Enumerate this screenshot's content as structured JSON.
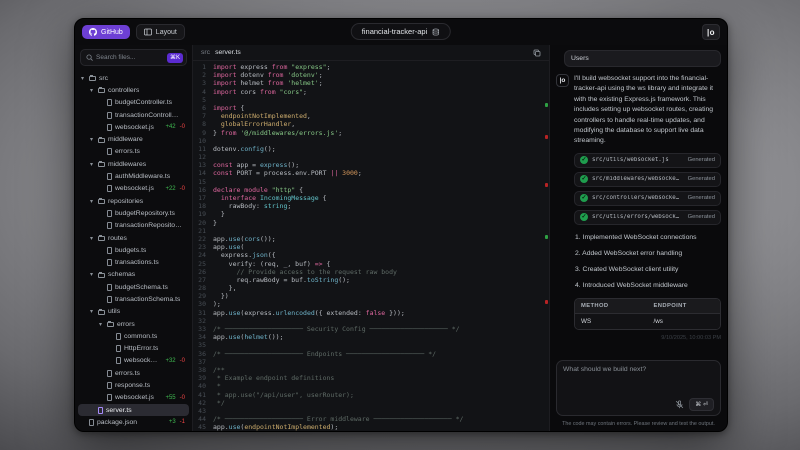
{
  "window": {
    "title": "financial-tracker-api"
  },
  "topbar": {
    "github_label": "GitHub",
    "layout_label": "Layout",
    "logo": "|o"
  },
  "sidebar": {
    "search": {
      "placeholder": "Search files...",
      "shortcut": "⌘K"
    },
    "tree": [
      {
        "d": 0,
        "t": "folder",
        "label": "src"
      },
      {
        "d": 1,
        "t": "folder",
        "label": "controllers"
      },
      {
        "d": 2,
        "t": "file",
        "label": "budgetController.ts"
      },
      {
        "d": 2,
        "t": "file",
        "label": "transactionController.ts"
      },
      {
        "d": 2,
        "t": "file",
        "label": "websocket.js",
        "add": "+42",
        "del": "-0"
      },
      {
        "d": 1,
        "t": "folder",
        "label": "middleware"
      },
      {
        "d": 2,
        "t": "file",
        "label": "errors.ts"
      },
      {
        "d": 1,
        "t": "folder",
        "label": "middlewares"
      },
      {
        "d": 2,
        "t": "file",
        "label": "authMiddleware.ts"
      },
      {
        "d": 2,
        "t": "file",
        "label": "websocket.js",
        "add": "+22",
        "del": "-0"
      },
      {
        "d": 1,
        "t": "folder",
        "label": "repositories"
      },
      {
        "d": 2,
        "t": "file",
        "label": "budgetRepository.ts"
      },
      {
        "d": 2,
        "t": "file",
        "label": "transactionRepository.ts"
      },
      {
        "d": 1,
        "t": "folder",
        "label": "routes"
      },
      {
        "d": 2,
        "t": "file",
        "label": "budgets.ts"
      },
      {
        "d": 2,
        "t": "file",
        "label": "transactions.ts"
      },
      {
        "d": 1,
        "t": "folder",
        "label": "schemas"
      },
      {
        "d": 2,
        "t": "file",
        "label": "budgetSchema.ts"
      },
      {
        "d": 2,
        "t": "file",
        "label": "transactionSchema.ts"
      },
      {
        "d": 1,
        "t": "folder",
        "label": "utils"
      },
      {
        "d": 2,
        "t": "folder",
        "label": "errors"
      },
      {
        "d": 3,
        "t": "file",
        "label": "common.ts"
      },
      {
        "d": 3,
        "t": "file",
        "label": "HttpError.ts"
      },
      {
        "d": 3,
        "t": "file",
        "label": "websocket.js",
        "add": "+32",
        "del": "-0"
      },
      {
        "d": 2,
        "t": "file",
        "label": "errors.ts"
      },
      {
        "d": 2,
        "t": "file",
        "label": "response.ts"
      },
      {
        "d": 2,
        "t": "file",
        "label": "websocket.js",
        "add": "+55",
        "del": "-0"
      },
      {
        "d": 1,
        "t": "file",
        "label": "server.ts",
        "sel": true
      },
      {
        "d": 0,
        "t": "file",
        "label": "package.json",
        "add": "+3",
        "del": "-1"
      }
    ]
  },
  "editor": {
    "breadcrumb": {
      "dir": "src",
      "file": "server.ts"
    },
    "lines": [
      [
        [
          "k",
          "import"
        ],
        [
          "p",
          " express "
        ],
        [
          "k",
          "from"
        ],
        [
          "s",
          " \"express\""
        ],
        [
          "p",
          ";"
        ]
      ],
      [
        [
          "k",
          "import"
        ],
        [
          "p",
          " dotenv "
        ],
        [
          "k",
          "from"
        ],
        [
          "s",
          " 'dotenv'"
        ],
        [
          "p",
          ";"
        ]
      ],
      [
        [
          "k",
          "import"
        ],
        [
          "p",
          " helmet "
        ],
        [
          "k",
          "from"
        ],
        [
          "s",
          " 'helmet'"
        ],
        [
          "p",
          ";"
        ]
      ],
      [
        [
          "k",
          "import"
        ],
        [
          "p",
          " cors "
        ],
        [
          "k",
          "from"
        ],
        [
          "s",
          " \"cors\""
        ],
        [
          "p",
          ";"
        ]
      ],
      [],
      [
        [
          "k",
          "import"
        ],
        [
          "p",
          " {"
        ]
      ],
      [
        [
          "y",
          "  endpointNotImplemented"
        ],
        [
          "p",
          ","
        ]
      ],
      [
        [
          "y",
          "  globalErrorHandler"
        ],
        [
          "p",
          ","
        ]
      ],
      [
        [
          "p",
          "} "
        ],
        [
          "k",
          "from"
        ],
        [
          "s",
          " '@/middlewares/errors.js'"
        ],
        [
          "p",
          ";"
        ]
      ],
      [],
      [
        [
          "p",
          "dotenv."
        ],
        [
          "f",
          "config"
        ],
        [
          "p",
          "();"
        ]
      ],
      [],
      [
        [
          "k",
          "const"
        ],
        [
          "p",
          " app = "
        ],
        [
          "f",
          "express"
        ],
        [
          "p",
          "();"
        ]
      ],
      [
        [
          "k",
          "const"
        ],
        [
          "p",
          " PORT = process.env.PORT "
        ],
        [
          "k",
          "||"
        ],
        [
          "n",
          " 3000"
        ],
        [
          "p",
          ";"
        ]
      ],
      [],
      [
        [
          "k",
          "declare module"
        ],
        [
          "s",
          " \"http\""
        ],
        [
          "p",
          " {"
        ]
      ],
      [
        [
          "p",
          "  "
        ],
        [
          "k",
          "interface"
        ],
        [
          "t",
          " IncomingMessage"
        ],
        [
          "p",
          " {"
        ]
      ],
      [
        [
          "p",
          "    rawBody: "
        ],
        [
          "t",
          "string"
        ],
        [
          "p",
          ";"
        ]
      ],
      [
        [
          "p",
          "  }"
        ]
      ],
      [
        [
          "p",
          "}"
        ]
      ],
      [],
      [
        [
          "p",
          "app."
        ],
        [
          "f",
          "use"
        ],
        [
          "p",
          "("
        ],
        [
          "f",
          "cors"
        ],
        [
          "p",
          "());"
        ]
      ],
      [
        [
          "p",
          "app."
        ],
        [
          "f",
          "use"
        ],
        [
          "p",
          "("
        ]
      ],
      [
        [
          "p",
          "  express."
        ],
        [
          "f",
          "json"
        ],
        [
          "p",
          "({"
        ]
      ],
      [
        [
          "p",
          "    verify: (req, _, buf) "
        ],
        [
          "k",
          "=>"
        ],
        [
          "p",
          " {"
        ]
      ],
      [
        [
          "c",
          "      // Provide access to the request raw body"
        ]
      ],
      [
        [
          "p",
          "      req.rawBody = buf."
        ],
        [
          "f",
          "toString"
        ],
        [
          "p",
          "();"
        ]
      ],
      [
        [
          "p",
          "    },"
        ]
      ],
      [
        [
          "p",
          "  })"
        ]
      ],
      [
        [
          "p",
          ");"
        ]
      ],
      [
        [
          "p",
          "app."
        ],
        [
          "f",
          "use"
        ],
        [
          "p",
          "(express."
        ],
        [
          "f",
          "urlencoded"
        ],
        [
          "p",
          "({ extended: "
        ],
        [
          "k",
          "false"
        ],
        [
          "p",
          " }));"
        ]
      ],
      [],
      [
        [
          "c",
          "/* ──────────────────── Security Config ──────────────────── */"
        ]
      ],
      [
        [
          "p",
          "app."
        ],
        [
          "f",
          "use"
        ],
        [
          "p",
          "("
        ],
        [
          "f",
          "helmet"
        ],
        [
          "p",
          "());"
        ]
      ],
      [],
      [
        [
          "c",
          "/* ──────────────────── Endpoints ──────────────────── */"
        ]
      ],
      [],
      [
        [
          "c",
          "/**"
        ]
      ],
      [
        [
          "c",
          " * Example endpoint definitions"
        ]
      ],
      [
        [
          "c",
          " *"
        ]
      ],
      [
        [
          "c",
          " * app.use(\"/api/user\", userRouter);"
        ]
      ],
      [
        [
          "c",
          " */"
        ]
      ],
      [],
      [
        [
          "c",
          "/* ──────────────────── Error middleware ──────────────────── */"
        ]
      ],
      [
        [
          "p",
          "app."
        ],
        [
          "f",
          "use"
        ],
        [
          "p",
          "("
        ],
        [
          "y",
          "endpointNotImplemented"
        ],
        [
          "p",
          ");"
        ]
      ]
    ]
  },
  "chat": {
    "user_message": "Users",
    "assistant": {
      "avatar": "|o",
      "message": "I'll build websocket support into the financial-tracker-api using the ws library and integrate it with the existing Express.js framework. This includes setting up websocket routes, creating controllers to handle real-time updates, and modifying the database to support live data streaming."
    },
    "files": [
      {
        "path": "src/utils/websocket.js",
        "status": "Generated"
      },
      {
        "path": "src/middlewares/websocke…",
        "status": "Generated"
      },
      {
        "path": "src/controllers/websocke…",
        "status": "Generated"
      },
      {
        "path": "src/utils/errors/websock…",
        "status": "Generated"
      }
    ],
    "steps": [
      "Implemented WebSocket connections",
      "Added WebSocket error handling",
      "Created WebSocket client utility",
      "Introduced WebSocket middleware"
    ],
    "table": {
      "headers": [
        "METHOD",
        "ENDPOINT"
      ],
      "rows": [
        [
          "WS",
          "/ws"
        ]
      ]
    },
    "timestamp": "9/10/2025, 10:00:03 PM",
    "input": {
      "placeholder": "What should we build next?",
      "send_shortcut": "⌘ ⏎"
    },
    "footer": "The code may contain errors. Please review and test the output."
  },
  "colors": {
    "accent": "#6d3fd4",
    "added": "#3fb950",
    "removed": "#ef4444",
    "generated_check": "#1f9d4e"
  }
}
